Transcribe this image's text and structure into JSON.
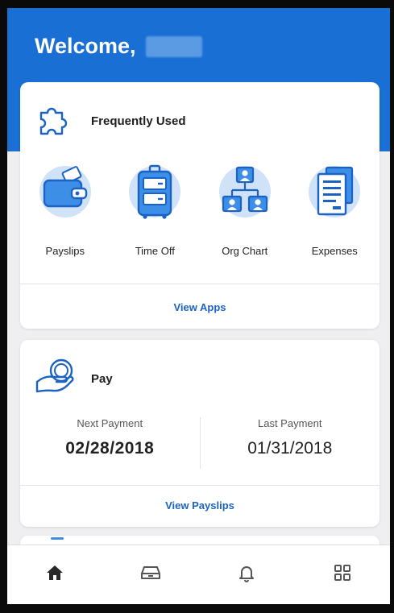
{
  "header": {
    "welcome_text": "Welcome,"
  },
  "frequently_used": {
    "title": "Frequently Used",
    "apps": [
      {
        "label": "Payslips",
        "icon": "wallet-icon"
      },
      {
        "label": "Time Off",
        "icon": "suitcase-icon"
      },
      {
        "label": "Org Chart",
        "icon": "org-chart-icon"
      },
      {
        "label": "Expenses",
        "icon": "document-icon"
      }
    ],
    "link_label": "View Apps"
  },
  "pay": {
    "title": "Pay",
    "next_payment_label": "Next Payment",
    "next_payment_date": "02/28/2018",
    "last_payment_label": "Last Payment",
    "last_payment_date": "01/31/2018",
    "link_label": "View Payslips"
  },
  "tabbar": {
    "tabs": [
      "home-icon",
      "inbox-icon",
      "bell-icon",
      "apps-grid-icon"
    ],
    "active_index": 0
  },
  "colors": {
    "brand_blue": "#1a6fd4",
    "link_blue": "#1a63c4",
    "icon_light": "#cfe2f7",
    "icon_mid": "#3d8ee6"
  }
}
